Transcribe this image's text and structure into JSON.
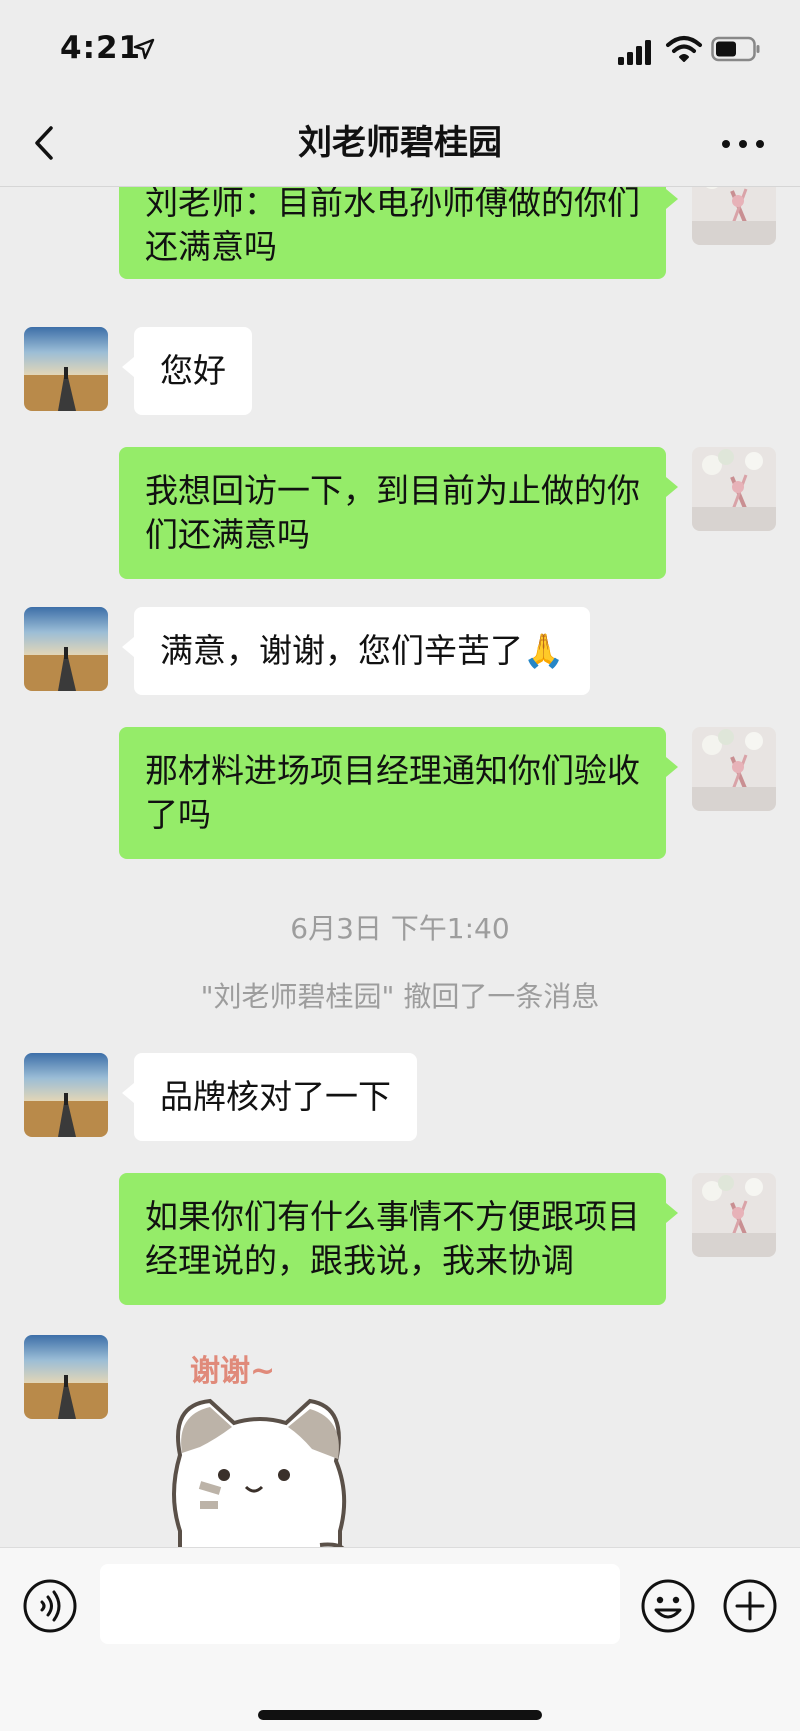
{
  "status_bar": {
    "time": "4:21",
    "icons": [
      "location-arrow-icon",
      "signal-icon",
      "wifi-icon",
      "battery-icon"
    ]
  },
  "nav": {
    "title": "刘老师碧桂园",
    "back_icon": "chevron-left-icon",
    "more_icon": "more-dots-icon"
  },
  "colors": {
    "background": "#ededed",
    "outgoing_bubble": "#95ec69",
    "incoming_bubble": "#ffffff",
    "system_text": "#9d9d9d"
  },
  "messages": [
    {
      "side": "right",
      "text": "刘老师：目前水电孙师傅做的你们还满意吗"
    },
    {
      "side": "left",
      "text": "您好"
    },
    {
      "side": "right",
      "text": "我想回访一下，到目前为止做的你们还满意吗"
    },
    {
      "side": "left",
      "text": "满意，谢谢，您们辛苦了🙏"
    },
    {
      "side": "right",
      "text": "那材料进场项目经理通知你们验收了吗"
    },
    {
      "side": "left",
      "text": "品牌核对了一下"
    },
    {
      "side": "right",
      "text": "如果你们有什么事情不方便跟项目经理说的，跟我说，我来协调"
    }
  ],
  "system": {
    "timestamp": "6月3日 下午1:40",
    "recall_notice": "\"刘老师碧桂园\" 撤回了一条消息"
  },
  "sticker": {
    "caption": "谢谢~",
    "icon": "cat-sticker-icon"
  },
  "input_bar": {
    "message_value": "",
    "icons": [
      "voice-icon",
      "emoji-icon",
      "plus-icon"
    ]
  }
}
